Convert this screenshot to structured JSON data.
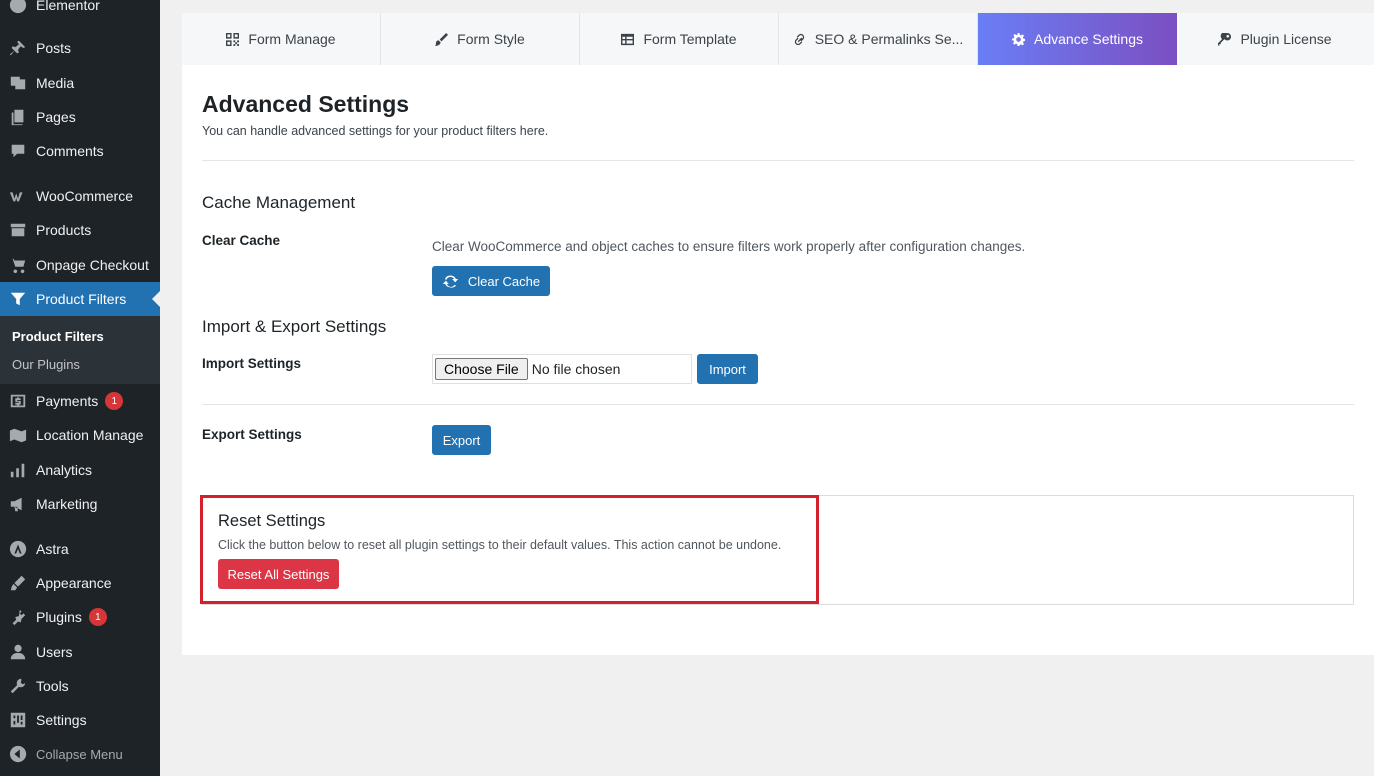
{
  "sidebar": {
    "top_item": "Elementor",
    "items": [
      {
        "label": "Posts"
      },
      {
        "label": "Media"
      },
      {
        "label": "Pages"
      },
      {
        "label": "Comments"
      },
      {
        "label": "WooCommerce"
      },
      {
        "label": "Products"
      },
      {
        "label": "Onpage Checkout"
      },
      {
        "label": "Product Filters"
      },
      {
        "label": "Payments",
        "badge": "1"
      },
      {
        "label": "Location Manage"
      },
      {
        "label": "Analytics"
      },
      {
        "label": "Marketing"
      },
      {
        "label": "Astra"
      },
      {
        "label": "Appearance"
      },
      {
        "label": "Plugins",
        "badge": "1"
      },
      {
        "label": "Users"
      },
      {
        "label": "Tools"
      },
      {
        "label": "Settings"
      }
    ],
    "submenu": [
      "Product Filters",
      "Our Plugins"
    ],
    "collapse_label": "Collapse Menu"
  },
  "tabs": [
    {
      "label": "Form Manage",
      "icon": "qr-grid-icon"
    },
    {
      "label": "Form Style",
      "icon": "brush-icon"
    },
    {
      "label": "Form Template",
      "icon": "table-icon"
    },
    {
      "label": "SEO & Permalinks Se...",
      "icon": "link-icon"
    },
    {
      "label": "Advance Settings",
      "icon": "gear-icon",
      "active": true
    },
    {
      "label": "Plugin License",
      "icon": "key-icon"
    }
  ],
  "page": {
    "title": "Advanced Settings",
    "subtitle": "You can handle advanced settings for your product filters here."
  },
  "cache": {
    "title": "Cache Management",
    "label": "Clear Cache",
    "description": "Clear WooCommerce and object caches to ensure filters work properly after configuration changes.",
    "button": "Clear Cache"
  },
  "import_export": {
    "title": "Import & Export Settings",
    "import_label": "Import Settings",
    "choose_file": "Choose File",
    "no_file": "No file chosen",
    "import_button": "Import",
    "export_label": "Export Settings",
    "export_button": "Export"
  },
  "reset": {
    "title": "Reset Settings",
    "description": "Click the button below to reset all plugin settings to their default values. This action cannot be undone.",
    "button": "Reset All Settings"
  },
  "colors": {
    "wp_blue": "#2271b1",
    "sidebar_bg": "#1d2327",
    "danger": "#dc3545",
    "highlight": "#d4202a",
    "tab_gradient_start": "#6a7ef5",
    "tab_gradient_end": "#7b4fc2"
  }
}
